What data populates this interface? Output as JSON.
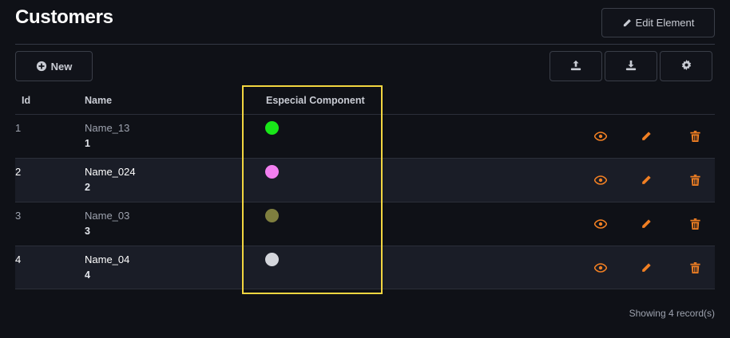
{
  "header": {
    "title": "Customers",
    "edit_button_label": "Edit Element"
  },
  "toolbar": {
    "new_button_label": "New"
  },
  "table": {
    "columns": [
      "Id",
      "Name",
      "Especial Component"
    ],
    "rows": [
      {
        "id": "1",
        "name": "Name_13",
        "sub": "1",
        "color": "#19e619"
      },
      {
        "id": "2",
        "name": "Name_024",
        "sub": "2",
        "color": "#f27ff0"
      },
      {
        "id": "3",
        "name": "Name_03",
        "sub": "3",
        "color": "#7f7f3f"
      },
      {
        "id": "4",
        "name": "Name_04",
        "sub": "4",
        "color": "#d4d6dc"
      }
    ]
  },
  "footer": {
    "record_count": "Showing 4 record(s)"
  },
  "colors": {
    "accent_icon": "#f07f23",
    "highlight": "#f3d640"
  }
}
